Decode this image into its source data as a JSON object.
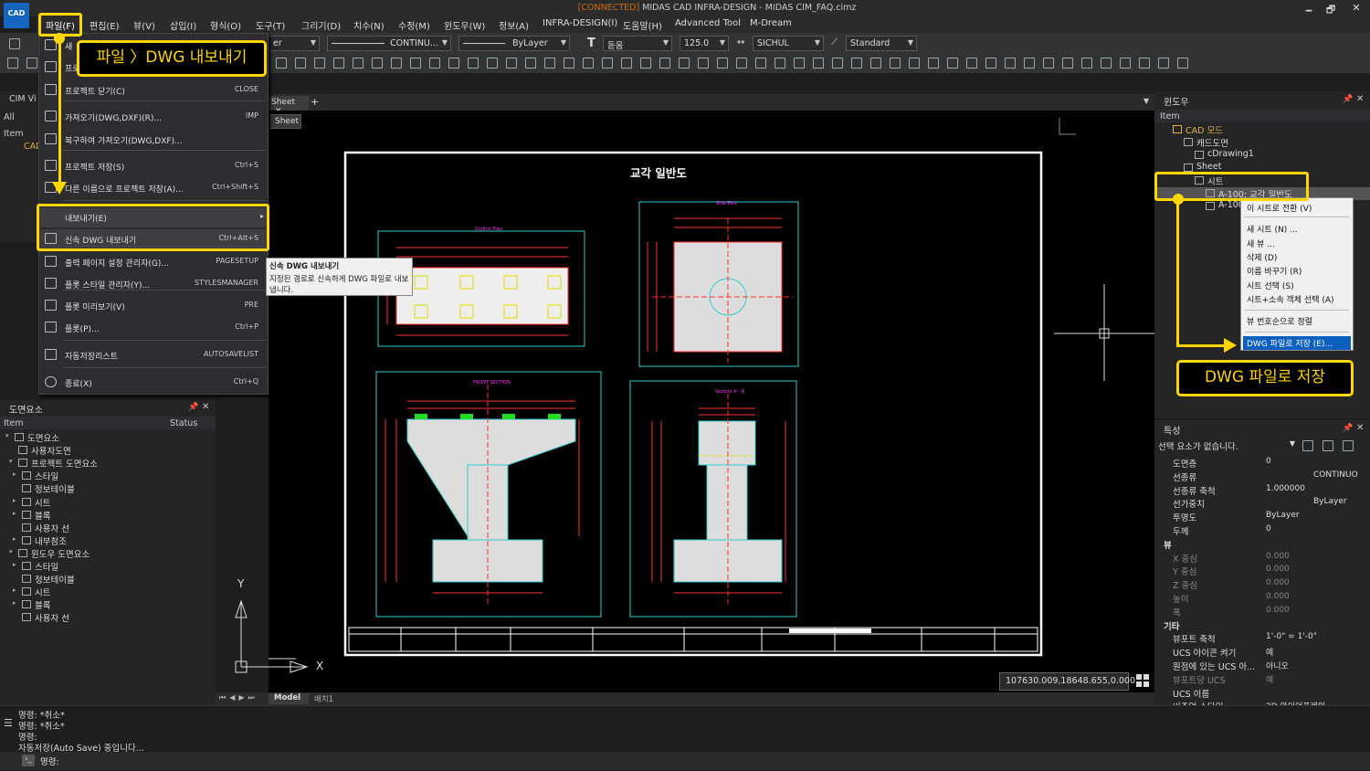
{
  "app": {
    "logo_text": "CAD",
    "title_conn": "[CONNECTED]",
    "title_rest": "MIDAS CAD INFRA-DESIGN - MIDAS CIM_FAQ.cimz"
  },
  "window_controls": [
    "🗕",
    "🗗",
    "✕"
  ],
  "menu": [
    "파일(F)",
    "편집(E)",
    "뷰(V)",
    "삽입(I)",
    "형식(O)",
    "도구(T)",
    "그리기(D)",
    "치수(N)",
    "수정(M)",
    "윈도우(W)",
    "정보(A)",
    "INFRA-DESIGN(I)",
    "도움말(H)",
    "Advanced Tool",
    "M-Dream"
  ],
  "toolbar": {
    "layer_combo": "er",
    "linetype_combo": "CONTINU...",
    "lineweight_combo": "ByLayer",
    "font_combo": "돋움",
    "textsize_combo": "125.0",
    "textstyle_combo": "SICHUL",
    "dimstyle_combo": "Standard"
  },
  "left_top": {
    "cim_view": "CIM Vi",
    "all": "All",
    "item": "Item",
    "cad": "CAD"
  },
  "file_menu": [
    {
      "label": "새",
      "shortcut": "",
      "icon": "new-icon"
    },
    {
      "label": "프로",
      "shortcut": "",
      "icon": "open-icon"
    },
    {
      "label": "프로젝트 닫기(C)",
      "shortcut": "CLOSE",
      "icon": "close-project-icon"
    },
    {
      "label": "가져오기(DWG,DXF)(R)...",
      "shortcut": "IMP",
      "icon": "import-icon"
    },
    {
      "label": "복구하여 가져오기(DWG,DXF)...",
      "shortcut": "",
      "icon": "recover-import-icon"
    },
    {
      "label": "프로젝트 저장(S)",
      "shortcut": "Ctrl+S",
      "icon": "save-icon"
    },
    {
      "label": "다른 이름으로 프로젝트 저장(A)...",
      "shortcut": "Ctrl+Shift+S",
      "icon": "save-as-icon"
    },
    {
      "label": "내보내기(E)",
      "shortcut": "▸",
      "icon": ""
    },
    {
      "label": "신속 DWG 내보내기",
      "shortcut": "Ctrl+Alt+S",
      "icon": "quick-dwg-icon"
    },
    {
      "label": "출력 페이지 설정 관리자(G)...",
      "shortcut": "PAGESETUP",
      "icon": "page-setup-icon"
    },
    {
      "label": "플롯 스타일 관리자(Y)...",
      "shortcut": "STYLESMANAGER",
      "icon": "plot-style-icon"
    },
    {
      "label": "플롯 미리보기(V)",
      "shortcut": "PRE",
      "icon": "plot-preview-icon"
    },
    {
      "label": "플롯(P)...",
      "shortcut": "Ctrl+P",
      "icon": "plot-icon"
    },
    {
      "label": "자동저장리스트",
      "shortcut": "AUTOSAVELIST",
      "icon": "autosave-icon"
    },
    {
      "label": "종료(X)",
      "shortcut": "Ctrl+Q",
      "icon": "power-icon"
    }
  ],
  "callouts": {
    "file_export": "파일 〉DWG 내보내기",
    "save_dwg": "DWG 파일로 저장"
  },
  "tooltip": {
    "title": "신속 DWG 내보내기",
    "body": "지정된 경로로 신속하게 DWG 파일로 내보냅니다."
  },
  "sheet_tabs": {
    "tab": "Sheet",
    "close": "✕",
    "add": "+",
    "sub": "Sheet"
  },
  "drawing": {
    "title": "교각 일반도",
    "view_labels": [
      "Cutline Plan",
      "Side Elev",
      "FRONT SECTION",
      "Section A - A"
    ]
  },
  "axis": {
    "x": "X",
    "y": "Y"
  },
  "coords": "107630.009,18648.655,0.000",
  "model_tabs": {
    "model": "Model",
    "layout": "배치1"
  },
  "left_panel": {
    "title": "도면요소",
    "col_item": "Item",
    "col_status": "Status",
    "rows": [
      {
        "label": "도면요소",
        "exp": "▾",
        "level": 0
      },
      {
        "label": "사용자도면",
        "exp": "",
        "level": 1
      },
      {
        "label": "프로젝트 도면요소",
        "exp": "▾",
        "level": 1
      },
      {
        "label": "스타일",
        "exp": "▸",
        "level": 2
      },
      {
        "label": "정보테이블",
        "exp": "",
        "level": 2
      },
      {
        "label": "시트",
        "exp": "▸",
        "level": 2
      },
      {
        "label": "블록",
        "exp": "▸",
        "level": 2
      },
      {
        "label": "사용자 선",
        "exp": "",
        "level": 2
      },
      {
        "label": "내부참조",
        "exp": "▸",
        "level": 2
      },
      {
        "label": "윈도우 도면요소",
        "exp": "▾",
        "level": 1
      },
      {
        "label": "스타일",
        "exp": "▸",
        "level": 2
      },
      {
        "label": "정보테이블",
        "exp": "",
        "level": 2
      },
      {
        "label": "시트",
        "exp": "▸",
        "level": 2
      },
      {
        "label": "블록",
        "exp": "▸",
        "level": 2
      },
      {
        "label": "사용자 선",
        "exp": "",
        "level": 2
      }
    ]
  },
  "right_panel": {
    "title": "윈도우",
    "item": "Item",
    "rows": [
      {
        "label": "CAD 모드",
        "level": 0
      },
      {
        "label": "캐드도면",
        "level": 1
      },
      {
        "label": "cDrawing1",
        "level": 2
      },
      {
        "label": "Sheet",
        "level": 1
      },
      {
        "label": "시트",
        "level": 2
      },
      {
        "label": "A-100: 교각 일반도",
        "level": 3
      },
      {
        "label": "A-100",
        "level": 3
      }
    ]
  },
  "context_menu": [
    "이 시트로 전환 (V)",
    "새 시트 (N) ...",
    "새 뷰 ...",
    "삭제 (D)",
    "이름 바꾸기 (R)",
    "시트 선택 (S)",
    "시트+소속 객체 선택 (A)",
    "뷰 번호순으로 정렬",
    "DWG 파일로 저장 (E)..."
  ],
  "properties": {
    "title": "특성",
    "selection": "선택 요소가 없습니다.",
    "rows": [
      {
        "label": "도면층",
        "value": "0"
      },
      {
        "label": "선종류",
        "value": "CONTINUO"
      },
      {
        "label": "선종류 축척",
        "value": "1.000000"
      },
      {
        "label": "선가중치",
        "value": "ByLayer"
      },
      {
        "label": "투명도",
        "value": "ByLayer"
      },
      {
        "label": "두께",
        "value": "0"
      },
      {
        "label": "뷰",
        "value": "",
        "section": true
      },
      {
        "label": "X 중심",
        "value": "0.000",
        "dim": true
      },
      {
        "label": "Y 중심",
        "value": "0.000",
        "dim": true
      },
      {
        "label": "Z 중심",
        "value": "0.000",
        "dim": true
      },
      {
        "label": "높이",
        "value": "0.000",
        "dim": true
      },
      {
        "label": "폭",
        "value": "0.000",
        "dim": true
      },
      {
        "label": "기타",
        "value": "",
        "section": true
      },
      {
        "label": "뷰포트 축척",
        "value": "1'-0\" = 1'-0\""
      },
      {
        "label": "UCS 아이콘 켜기",
        "value": "예"
      },
      {
        "label": "원점에 있는 UCS 아...",
        "value": "아니오"
      },
      {
        "label": "뷰포트당 UCS",
        "value": "예",
        "dim": true
      },
      {
        "label": "UCS 이름",
        "value": ""
      },
      {
        "label": "비주얼 스타일",
        "value": "2D 와이어프레임"
      }
    ]
  },
  "command": {
    "lines": [
      "명령: *취소*",
      "명령: *취소*",
      "명령:",
      "자동저장(Auto Save) 중입니다..."
    ],
    "prompt": "명령:"
  }
}
